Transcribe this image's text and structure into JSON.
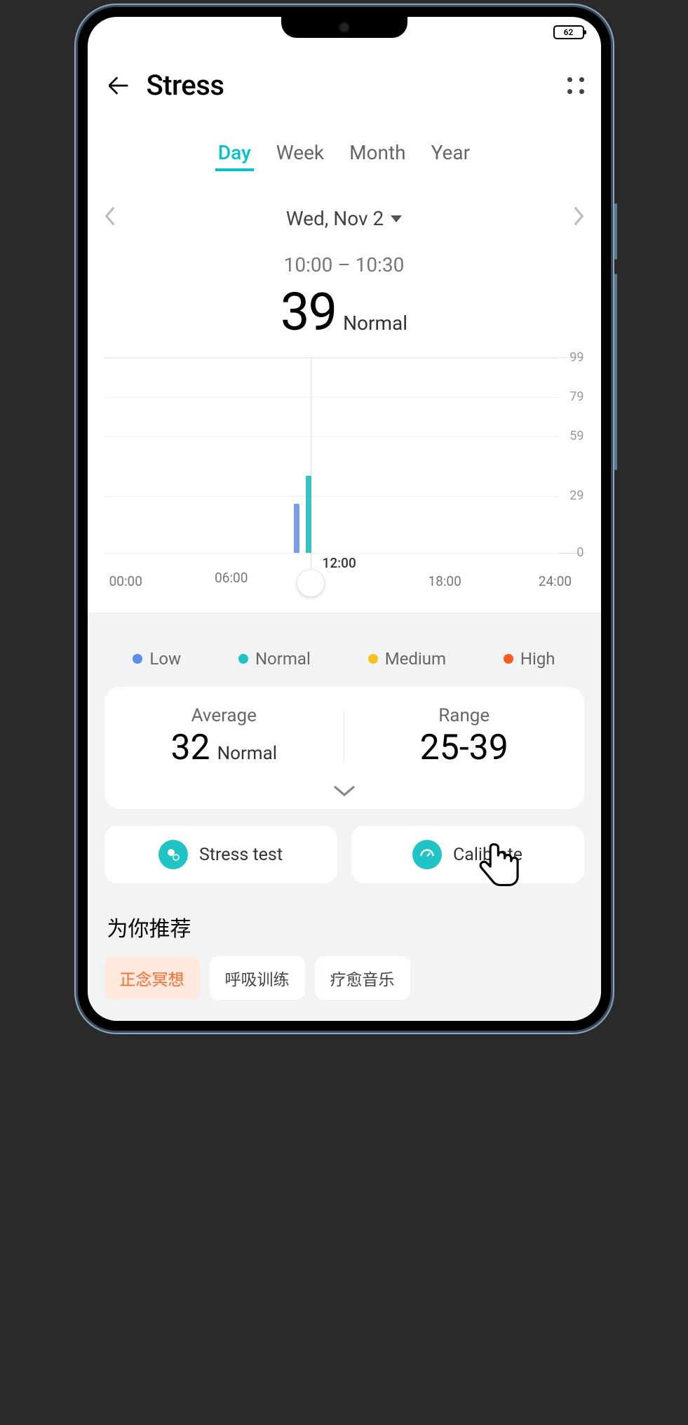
{
  "status": {
    "battery": "62"
  },
  "header": {
    "title": "Stress"
  },
  "tabs": {
    "items": [
      {
        "label": "Day",
        "active": true
      },
      {
        "label": "Week",
        "active": false
      },
      {
        "label": "Month",
        "active": false
      },
      {
        "label": "Year",
        "active": false
      }
    ]
  },
  "date": {
    "label": "Wed, Nov 2"
  },
  "reading": {
    "time_range": "10:00 – 10:30",
    "value": "39",
    "status": "Normal"
  },
  "chart_data": {
    "type": "bar",
    "ylim": [
      0,
      99
    ],
    "y_ticks": [
      0,
      29,
      59,
      79,
      99
    ],
    "x_ticks": [
      "00:00",
      "06:00",
      "12:00",
      "18:00",
      "24:00"
    ],
    "selected_x": "12:00",
    "bars": [
      {
        "x_hour": 10.0,
        "value": 25,
        "category": "Low"
      },
      {
        "x_hour": 10.5,
        "value": 39,
        "category": "Normal"
      }
    ]
  },
  "legend": {
    "items": [
      {
        "label": "Low",
        "color": "#5a8de8"
      },
      {
        "label": "Normal",
        "color": "#20c4c4"
      },
      {
        "label": "Medium",
        "color": "#f5c020"
      },
      {
        "label": "High",
        "color": "#f55a20"
      }
    ]
  },
  "stats": {
    "average": {
      "title": "Average",
      "value": "32",
      "status": "Normal"
    },
    "range": {
      "title": "Range",
      "value": "25-39"
    }
  },
  "actions": {
    "stress_test": "Stress test",
    "calibrate": "Calibrate"
  },
  "recommend": {
    "title": "为你推荐",
    "chips": [
      {
        "label": "正念冥想",
        "active": true
      },
      {
        "label": "呼吸训练",
        "active": false
      },
      {
        "label": "疗愈音乐",
        "active": false
      }
    ]
  }
}
